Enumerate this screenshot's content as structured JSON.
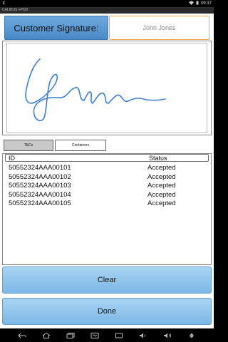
{
  "status_bar": {
    "left_text": "⊻",
    "time": "09:37"
  },
  "app_title": "CALIBUS ePOD",
  "signature": {
    "label": "Customer Signature:",
    "name_value": "John Jones"
  },
  "tabs": [
    {
      "label": "T&Cs"
    },
    {
      "label": "Containers"
    }
  ],
  "table": {
    "headers": [
      "ID",
      "Status"
    ],
    "rows": [
      [
        "50552324AAA00101",
        "Accepted"
      ],
      [
        "50552324AAA00102",
        "Accepted"
      ],
      [
        "50552324AAA00103",
        "Accepted"
      ],
      [
        "50552324AAA00104",
        "Accepted"
      ],
      [
        "50552324AAA00105",
        "Accepted"
      ]
    ]
  },
  "buttons": {
    "clear": "Clear",
    "done": "Done"
  },
  "nav_icons": [
    "back-icon",
    "home-icon",
    "recent-apps-icon",
    "screenshot-icon",
    "fullscreen-icon",
    "volume-down-icon",
    "volume-up-icon",
    "menu-icon"
  ],
  "colors": {
    "button_blue": "#7cb8e6",
    "label_blue": "#4a8ac7",
    "name_border": "#f0a64a",
    "signature_ink": "#3b7fd0"
  }
}
